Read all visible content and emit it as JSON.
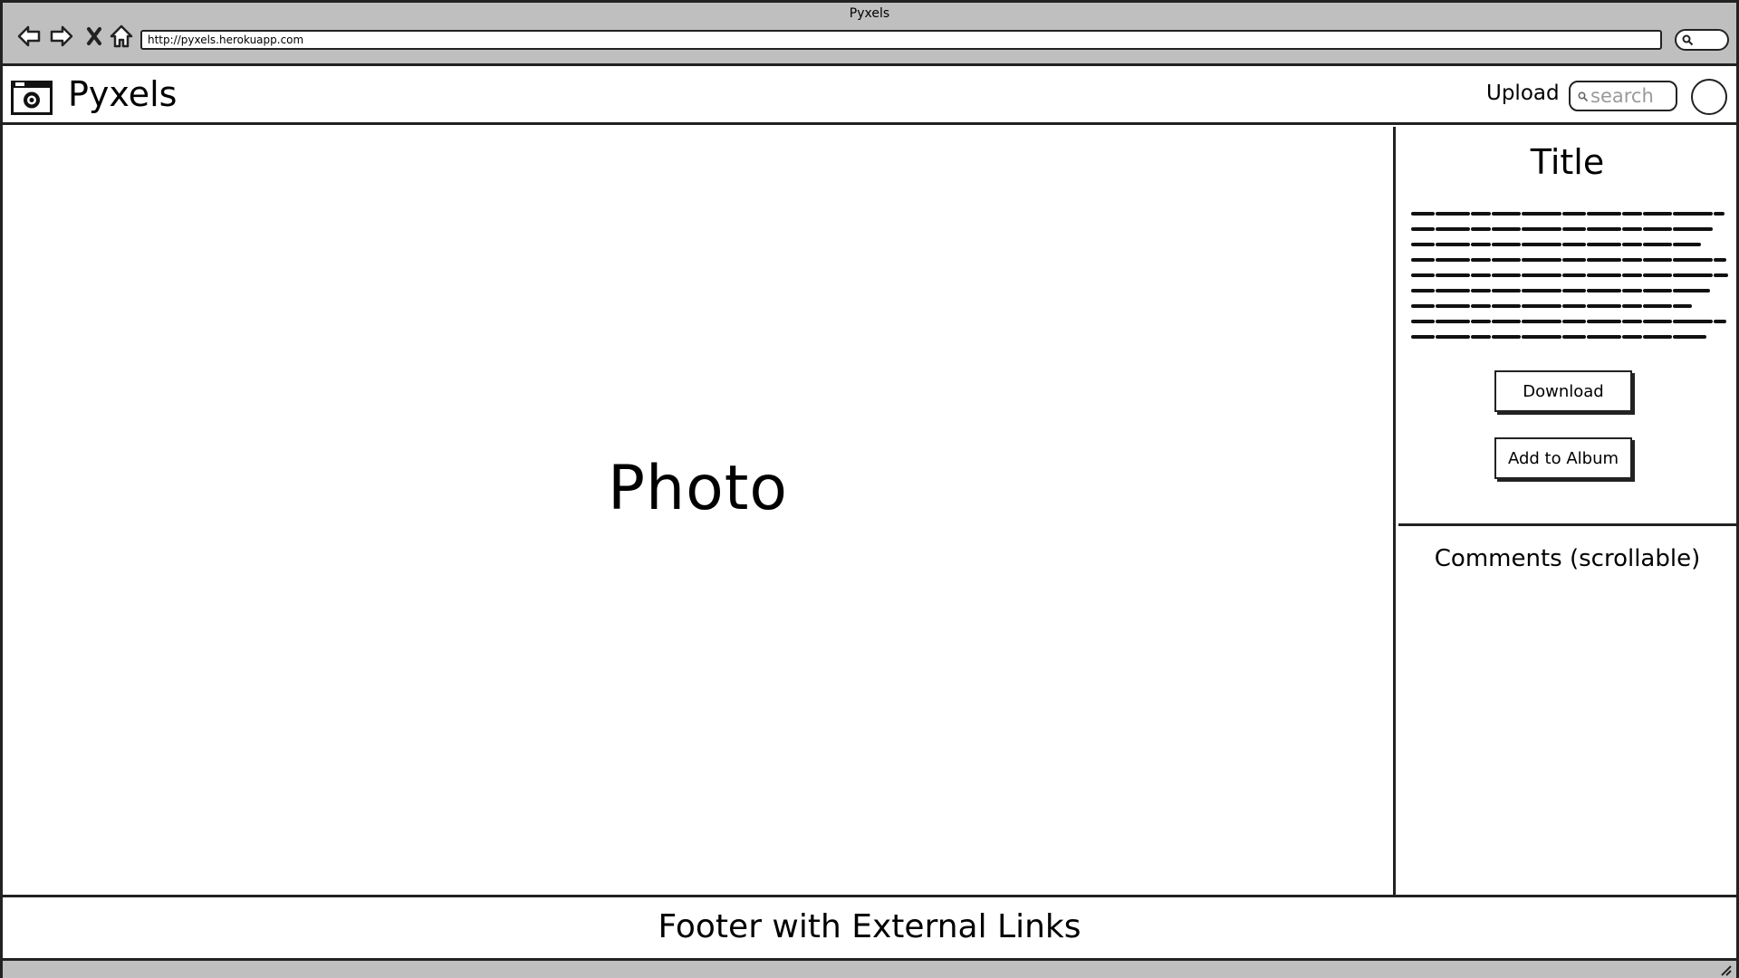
{
  "browser": {
    "window_title": "Pyxels",
    "url": "http://pyxels.herokuapp.com"
  },
  "header": {
    "app_name": "Pyxels",
    "upload_label": "Upload",
    "search_placeholder": "search"
  },
  "main": {
    "photo_label": "Photo"
  },
  "sidebar": {
    "title": "Title",
    "download_label": "Download",
    "add_to_album_label": "Add to Album",
    "comments_label": "Comments (scrollable)"
  },
  "footer": {
    "text": "Footer with External Links"
  },
  "icons": {
    "back": "back-arrow-icon",
    "forward": "forward-arrow-icon",
    "stop": "close-icon",
    "home": "home-icon",
    "search": "search-icon",
    "logo": "camera-icon",
    "avatar": "avatar",
    "resize": "resize-grip-icon"
  }
}
